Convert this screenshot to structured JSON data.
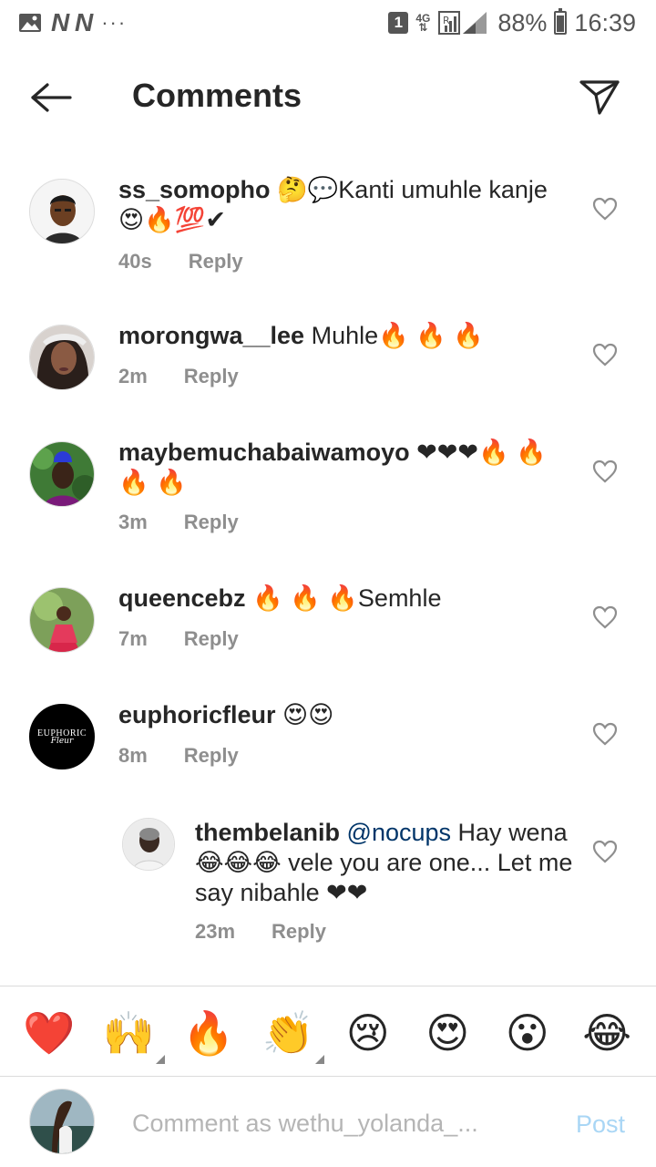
{
  "status_bar": {
    "carrier_marks": "N N",
    "dots": "···",
    "sim_badge": "1",
    "network": "4G",
    "battery": "88%",
    "time": "16:39"
  },
  "header": {
    "title": "Comments"
  },
  "comments": [
    {
      "username": "ss_somopho",
      "text": "🤔💬Kanti umuhle kanje 😍🔥💯✔",
      "time": "40s",
      "reply_label": "Reply"
    },
    {
      "username": "morongwa__lee",
      "text": "Muhle🔥 🔥 🔥",
      "time": "2m",
      "reply_label": "Reply"
    },
    {
      "username": "maybemuchabaiwamoyo",
      "text": "❤❤❤🔥 🔥 🔥 🔥",
      "time": "3m",
      "reply_label": "Reply"
    },
    {
      "username": "queencebz",
      "text": "🔥 🔥 🔥Semhle",
      "time": "7m",
      "reply_label": "Reply"
    },
    {
      "username": "euphoricfleur",
      "text": "😍😍",
      "time": "8m",
      "reply_label": "Reply",
      "avatar_text": "EUPHORIC",
      "avatar_script": "Fleur"
    },
    {
      "username": "thembelanib",
      "mention": "@nocups",
      "text": "Hay wena 😂😂😂 vele you are one... Let me say nibahle ❤❤",
      "time": "23m",
      "reply_label": "Reply"
    }
  ],
  "emoji_bar": [
    "❤️",
    "🙌",
    "🔥",
    "👏",
    "😢",
    "😍",
    "😮",
    "😂"
  ],
  "composer": {
    "placeholder": "Comment as wethu_yolanda_...",
    "post_label": "Post"
  },
  "colors": {
    "heart_red": "#ed4956",
    "meta_gray": "#8e8e8e",
    "post_blue": "#a9d6f5",
    "mention_blue": "#003569"
  }
}
